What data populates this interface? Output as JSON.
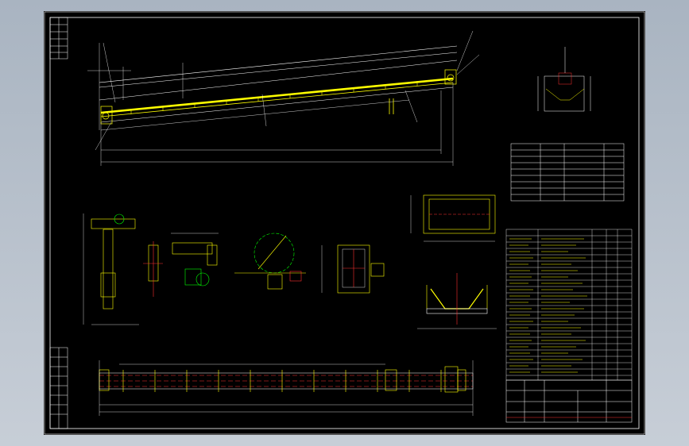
{
  "view": {
    "background": "#b8c1cc",
    "sheet_background": "#000000"
  },
  "colors": {
    "frame": "#ffffff",
    "conveyor": "#ffff00",
    "dimension": "#ffffff",
    "detail_green": "#00ff00",
    "detail_red": "#ff3030",
    "detail_cyan": "#00e0ff"
  },
  "drawing": {
    "views": [
      "inclined-conveyor-elevation",
      "head-section-detail",
      "drive-support-detail",
      "pulley-detail",
      "tail-frame-detail",
      "feed-hopper-plan",
      "idler-section",
      "conveyor-plan-view"
    ]
  }
}
